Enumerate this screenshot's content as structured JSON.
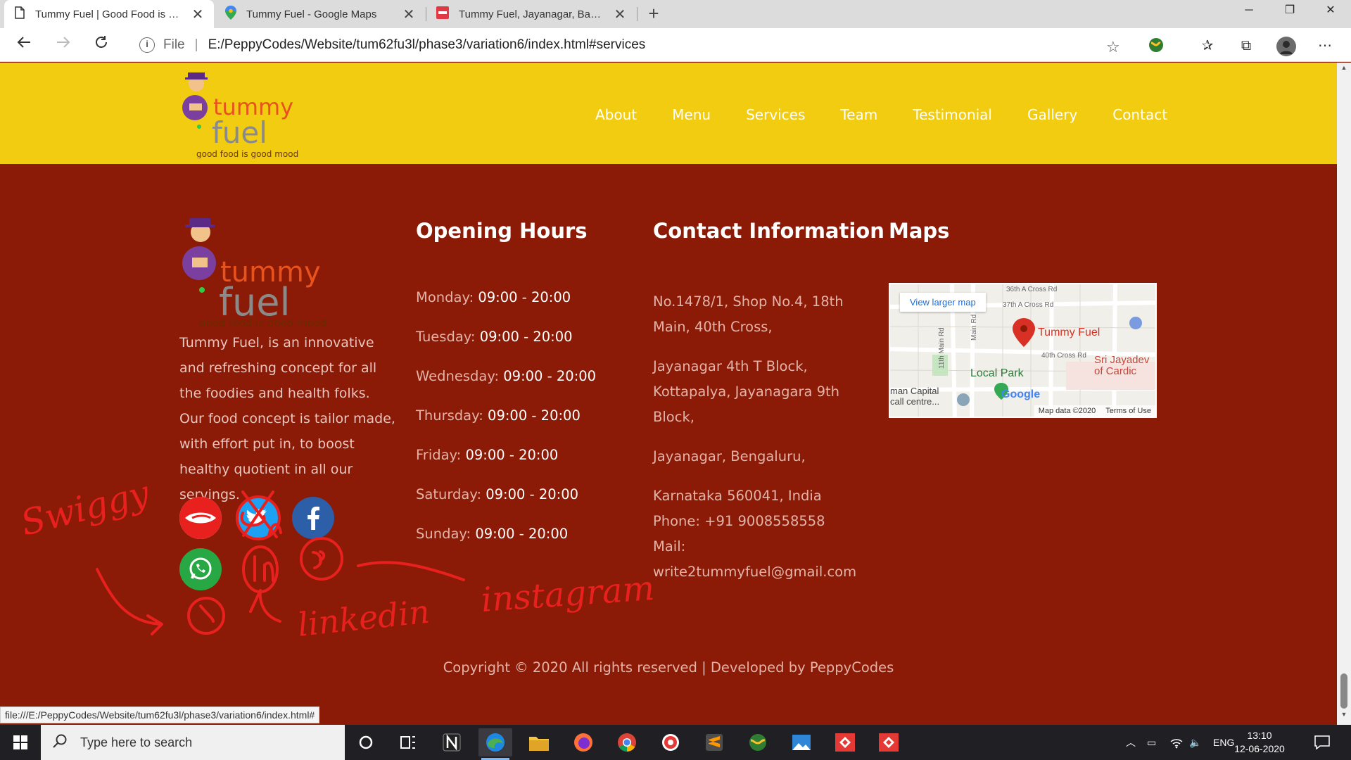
{
  "browser": {
    "tabs": [
      {
        "title": "Tummy Fuel | Good Food is Good Mood",
        "active": true
      },
      {
        "title": "Tummy Fuel - Google Maps",
        "active": false
      },
      {
        "title": "Tummy Fuel, Jayanagar, Bangalore",
        "active": false
      }
    ],
    "address": {
      "scheme": "File",
      "url": "E:/PeppyCodes/Website/tum62fu3l/phase3/variation6/index.html#services"
    },
    "status_url": "file:///E:/PeppyCodes/Website/tum62fu3l/phase3/variation6/index.html#"
  },
  "site": {
    "logo": {
      "line1": "tummy",
      "line2": "fuel",
      "tagline": "good food is good mood"
    },
    "nav": [
      "About",
      "Menu",
      "Services",
      "Team",
      "Testimonial",
      "Gallery",
      "Contact"
    ]
  },
  "footer": {
    "about_text": "Tummy Fuel, is an innovative and refreshing concept for all the foodies and health folks. Our food concept is tailor made, with effort put in, to boost healthy quotient in all our servings.",
    "hours_title": "Opening Hours",
    "hours": [
      {
        "day": "Monday:",
        "time": "09:00 - 20:00"
      },
      {
        "day": "Tuesday:",
        "time": "09:00 - 20:00"
      },
      {
        "day": "Wednesday:",
        "time": "09:00 - 20:00"
      },
      {
        "day": "Thursday:",
        "time": "09:00 - 20:00"
      },
      {
        "day": "Friday:",
        "time": "09:00 - 20:00"
      },
      {
        "day": "Saturday:",
        "time": "09:00 - 20:00"
      },
      {
        "day": "Sunday:",
        "time": "09:00 - 20:00"
      }
    ],
    "contact_title": "Contact Information",
    "contact": {
      "addr1": "No.1478/1, Shop No.4, 18th Main, 40th Cross,",
      "addr2": "Jayanagar 4th T Block, Kottapalya, Jayanagara 9th Block,",
      "addr3": "Jayanagar, Bengaluru,",
      "addr4": "Karnataka 560041, India",
      "phone": "Phone: +91 9008558558",
      "mail_label": "Mail:",
      "mail": "write2tummyfuel@gmail.com"
    },
    "maps_title": "Maps",
    "map": {
      "larger_link": "View larger map",
      "pin_label": "Tummy Fuel",
      "park": "Local Park",
      "hospital": "Sri Jayadev of Cardic",
      "street1": "36th A Cross Rd",
      "street2": "37th A Cross Rd",
      "street3": "40th Cross Rd",
      "street4": "11th Main Rd",
      "street5": "Main Rd",
      "place": "man Capital call centre...",
      "google": "Google",
      "map_data": "Map data ©2020",
      "terms": "Terms of Use"
    },
    "social": [
      "swiggy",
      "twitter",
      "facebook",
      "whatsapp"
    ],
    "annotations": {
      "swiggy": "Swiggy",
      "linkedin": "linkedin",
      "instagram": "instagram"
    },
    "copyright": "Copyright © 2020 All rights reserved | Developed by PeppyCodes"
  },
  "taskbar": {
    "search_placeholder": "Type here to search",
    "lang": "ENG",
    "time": "13:10",
    "date": "12-06-2020"
  },
  "colors": {
    "header_yellow": "#f1cc11",
    "footer_red": "#8b1a06",
    "ink_red": "#e8201e"
  }
}
